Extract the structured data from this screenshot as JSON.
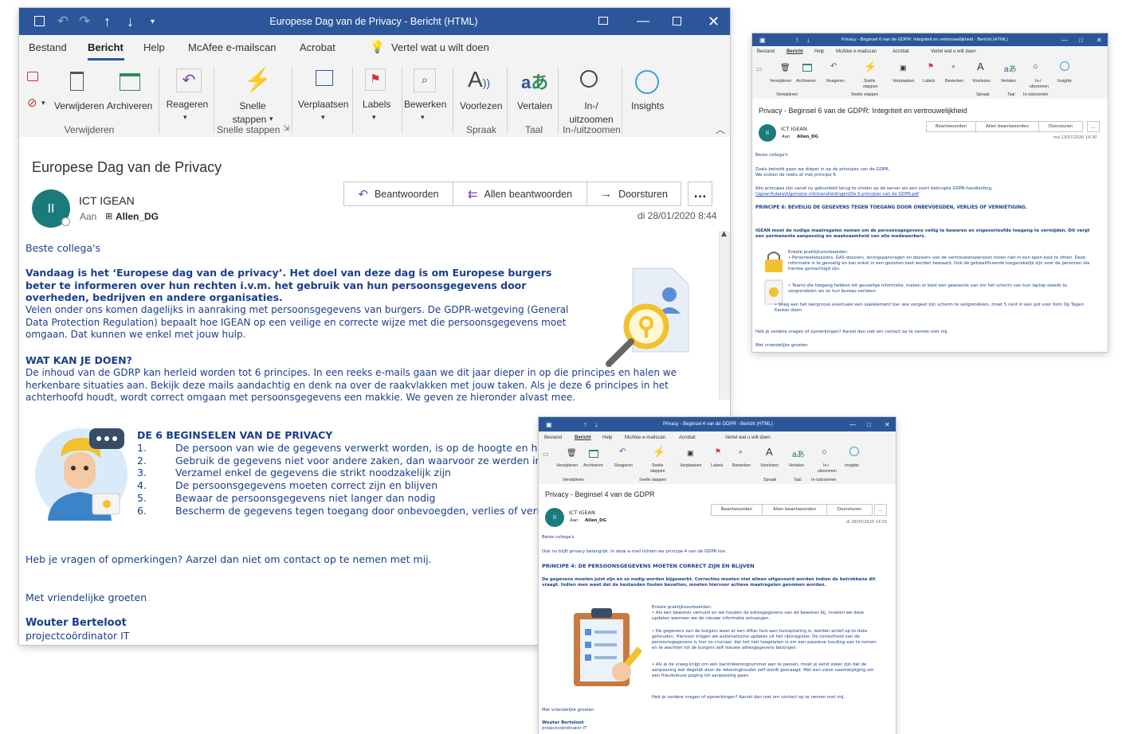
{
  "tabs": [
    "Bestand",
    "Bericht",
    "Help",
    "McAfee e-mailscan",
    "Acrobat"
  ],
  "tell_me": "Vertel wat u wilt doen",
  "ribbon": {
    "verwijderen": "Verwijderen",
    "archiveren": "Archiveren",
    "reageren": "Reageren",
    "snelle_1": "Snelle",
    "snelle_2": "stappen",
    "verplaatsen": "Verplaatsen",
    "labels": "Labels",
    "bewerken": "Bewerken",
    "voorlezen": "Voorlezen",
    "vertalen": "Vertalen",
    "zoom_1": "In-/",
    "zoom_2": "uitzoomen",
    "insights": "Insights",
    "group_verwijderen": "Verwijderen",
    "group_snelle": "Snelle stappen",
    "group_spraak": "Spraak",
    "group_taal": "Taal",
    "group_zoom": "In-/uitzoomen"
  },
  "actions": {
    "reply": "Beantwoorden",
    "reply_all": "Allen beantwoorden",
    "forward": "Doorsturen",
    "more": "..."
  },
  "common": {
    "sender": "ICT IGEAN",
    "to_label": "Aan",
    "recipient": "Allen_DG",
    "avatar": "II",
    "greeting": "Beste collega's",
    "regards": "Met vriendelijke groeten"
  },
  "main": {
    "window_title": "Europese Dag van de Privacy  -  Bericht (HTML)",
    "subject": "Europese Dag van de Privacy",
    "date": "di 28/01/2020 8:44",
    "intro_bold": "Vandaag is het ‘Europese dag van de privacy’. Het doel van deze dag is om Europese burgers beter te informeren over hun rechten i.v.m. het gebruik van hun persoonsgegevens door overheden, bedrijven en andere organisaties.",
    "intro_text": "Velen onder ons komen dagelijks in aanraking met persoonsgegevens van burgers. De GDPR-wetgeving (General Data Protection Regulation) bepaalt hoe IGEAN op een veilige en correcte wijze met die persoonsgegevens moet omgaan. Dat kunnen we enkel met jouw hulp.",
    "heading": "WAT KAN JE DOEN?",
    "body_text": "De inhoud van de GDRP kan herleid worden tot 6 principes. In een reeks e-mails gaan we dit jaar dieper in op die principes en halen we herkenbare situaties aan. Bekijk deze mails aandachtig en denk na over de raakvlakken met jouw taken. Als je deze 6 principes in het achterhoofd houdt, wordt correct omgaan met persoonsgegevens een makkie. We geven ze hieronder alvast mee.",
    "principles_title": "DE 6 BEGINSELEN VAN DE PRIVACY",
    "principles": [
      {
        "num": "1.",
        "text": "De persoon van wie de gegevens verwerkt worden, is op de hoogte en heeft toestemming gegeven"
      },
      {
        "num": "2.",
        "text": "Gebruik de gegevens niet voor andere zaken, dan waarvoor ze werden ingezameld"
      },
      {
        "num": "3.",
        "text": "Verzamel enkel de gegevens die strikt noodzakelijk zijn"
      },
      {
        "num": "4.",
        "text": "De persoonsgegevens moeten correct zijn en blijven"
      },
      {
        "num": "5.",
        "text": "Bewaar de persoonsgegevens niet langer dan nodig"
      },
      {
        "num": "6.",
        "text": "Bescherm de gegevens tegen toegang door onbevoegden, verlies of vernietiging"
      }
    ],
    "questions": "Heb je vragen of opmerkingen? Aarzel dan niet om contact op te nemen met mij.",
    "signature_name": "Wouter Berteloot",
    "signature_role": "projectcoördinator IT"
  },
  "win2": {
    "window_title": "Privacy - Beginsel 6 van de GDPR: Integriteit en vertrouwelijkheid  -  Bericht (HTML)",
    "subject": "Privacy - Beginsel 6 van de GDPR: Integriteit en vertrouwelijkheid",
    "date": "ma 13/07/2020 14:30",
    "p1": "Zoals beloofd gaan we dieper in op de principes van de GDPR.",
    "p2": "We sluiten de reeks af met principe 6.",
    "p3": "Alle principes zijn vanaf nu gebundeld terug te vinden op de server als een soort beknopte GDPR-handleiding:",
    "link": "\\\\igean4\\data\\Algemene info\\handleidingen\\De 6 principes van de GDPR.pdf",
    "heading": "PRINCIPE 6: BEVEILIG DE GEGEVENS TEGEN TOEGANG DOOR ONBEVOEGDEN, VERLIES OF VERNIETIGING.",
    "intro": "IGEAN moet de nodige maatregelen nemen om de persoonsgegevens veilig te bewaren en ongeoorloofde toegang te vermijden. Dit vergt een permanente aanpassing en waakzaamheid van alle medewerkers.",
    "examples": "Enkele praktijkvoorbeelden:",
    "ex1": "• Personeelsdossiers, GAS-dossiers, leningsaanvragen en dossiers van de vertrouwenspersoon horen niet in een open kast te zitten. Deze informatie is te gevoelig en kan enkel in een gesloten kast worden bewaard. Ook de gekwalificeerde toeganskelijk zijn voor de personen die hiertoe gemachtigd zijn.",
    "ex2": "• Teams die toegang hebben tot gevoelige informatie, maken er best een gewoonte van om het scherm van hun laptop steeds te vergrendelen als ze hun bureau verlaten.",
    "ex3": "• Voeg aan het leerproces eventueel een spelelement toe: wie vergeet zijn scherm te vergrendelen, moet 5 cent in een pot voor Kom Op Tegen Kanker doen.",
    "questions": "Heb je verdere vragen of opmerkingen? Aarzel dan niet om contact op te nemen met mij."
  },
  "win3": {
    "window_title": "Privacy - Beginsel 4 van de GDPR  -  Bericht (HTML)",
    "subject": "Privacy - Beginsel 4 van de GDPR",
    "date": "di 26/05/2020 14:03",
    "p1": "Ook nu blijft privacy belangrijk. In deze e-mail lichten we principe 4 van de GDPR toe.",
    "heading": "PRINCIPE 4: DE PERSOONSGEGEVENS MOETEN CORRECT ZIJN EN BLIJVEN",
    "intro": "De gegevens moeten juist zijn en zo nodig worden bijgewerkt. Correcties moeten niet alleen uitgevoerd worden indien de betrokkene dit vraagt. Indien men weet dat de bestanden fouten bevatten, moeten hiervoor actieve maatregelen genomen worden.",
    "examples": "Enkele praktijkvoorbeelden:",
    "ex1": "• Als een bewoner verhuist en we houden de adresgegevens van de bewoner bij, moeten we deze updaten wanneer we de nieuwe informatie ontvangen.",
    "ex2": "• De gegevens van de burgers waar er een diftar huis-aan-huisophaling is, worden actief up-to-date gehouden. Hiervoor krijgen we automatische updates uit het rijksregister. De correctheid van de persoonsgegevens is hier zo cruciaal, dat het niet toegelaten is om een passieve houding aan te nemen en te wachten tot de burgers zelf nieuwe adresgegevens bezorgen.",
    "ex3": "• Als je de vraag krijgt om een bankrekeningnummer aan te passen, moet je eerst zeker zijn dat de aanpassing wel degelijk door de rekeninghouder zelf wordt gevraagd. Met een valse naamwijziging om een frauduleuze poging tot aanpassing gaan.",
    "questions": "Heb je verdere vragen of opmerkingen? Aarzel dan niet om contact op te nemen met mij.",
    "signature_name": "Wouter Berteloot",
    "signature_role": "projectcoördinator IT"
  }
}
